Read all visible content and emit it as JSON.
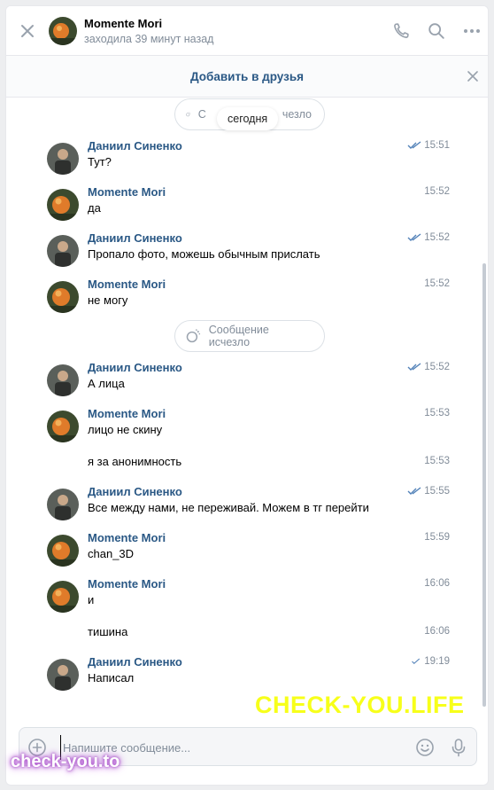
{
  "header": {
    "name": "Momente Mori",
    "status": "заходила 39 минут назад"
  },
  "friend_bar": {
    "label": "Добавить в друзья"
  },
  "date_chip": "сегодня",
  "system": {
    "disappeared": "Сообщение исчезло",
    "disappeared_partial_left": "С",
    "disappeared_partial_right": "чезло"
  },
  "messages": [
    {
      "author": "Даниил Синенко",
      "text": "Тут?",
      "time": "15:51",
      "read": "double"
    },
    {
      "author": "Momente Mori",
      "text": "да",
      "time": "15:52"
    },
    {
      "author": "Даниил Синенко",
      "text": "Пропало фото, можешь обычным прислать",
      "time": "15:52",
      "read": "double"
    },
    {
      "author": "Momente Mori",
      "text": "не могу",
      "time": "15:52"
    },
    {
      "author": "Даниил Синенко",
      "text": "А лица",
      "time": "15:52",
      "read": "double"
    },
    {
      "author": "Momente Mori",
      "text": "лицо не скину",
      "time": "15:53"
    },
    {
      "text": "я за анонимность",
      "time": "15:53"
    },
    {
      "author": "Даниил Синенко",
      "text": "Все между нами, не переживай. Можем в тг перейти",
      "time": "15:55",
      "read": "double"
    },
    {
      "author": "Momente Mori",
      "text": "chan_3D",
      "time": "15:59"
    },
    {
      "author": "Momente Mori",
      "text": "и",
      "time": "16:06"
    },
    {
      "text": "тишина",
      "time": "16:06"
    },
    {
      "author": "Даниил Синенко",
      "text": "Написал",
      "time": "19:19",
      "read": "single"
    }
  ],
  "composer": {
    "placeholder": "Напишите сообщение..."
  },
  "watermarks": {
    "primary": "CHECK-YOU.LIFE",
    "secondary": "check-you.to"
  },
  "colors": {
    "link": "#2a5885",
    "muted": "#818c99",
    "check": "#5181b8",
    "watermark_yellow": "#f7ff1a",
    "watermark_glow": "#b85fd6"
  }
}
